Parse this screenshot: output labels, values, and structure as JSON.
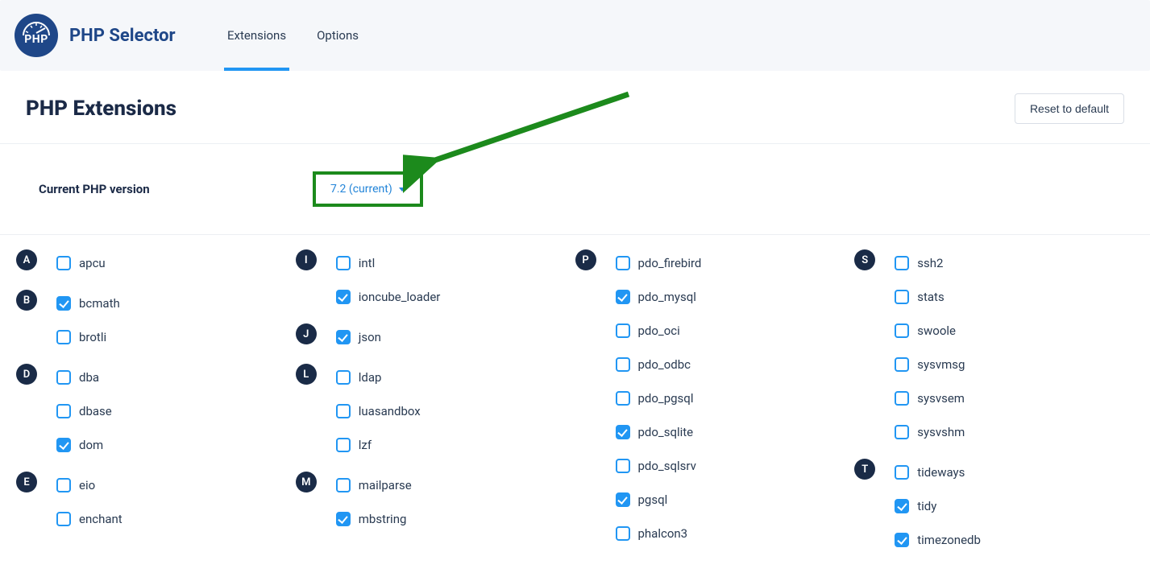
{
  "brand": "PHP Selector",
  "logo_label": "PHP",
  "tabs": {
    "extensions": "Extensions",
    "options": "Options"
  },
  "page_title": "PHP Extensions",
  "reset_label": "Reset to default",
  "version_label": "Current PHP version",
  "version_value": "7.2 (current)",
  "columns": [
    {
      "groups": [
        {
          "letter": "A",
          "items": [
            {
              "name": "apcu",
              "checked": false
            }
          ]
        },
        {
          "letter": "B",
          "items": [
            {
              "name": "bcmath",
              "checked": true
            },
            {
              "name": "brotli",
              "checked": false
            }
          ]
        },
        {
          "letter": "D",
          "items": [
            {
              "name": "dba",
              "checked": false
            },
            {
              "name": "dbase",
              "checked": false
            },
            {
              "name": "dom",
              "checked": true
            }
          ]
        },
        {
          "letter": "E",
          "items": [
            {
              "name": "eio",
              "checked": false
            },
            {
              "name": "enchant",
              "checked": false
            }
          ]
        }
      ]
    },
    {
      "groups": [
        {
          "letter": "I",
          "items": [
            {
              "name": "intl",
              "checked": false
            },
            {
              "name": "ioncube_loader",
              "checked": true
            }
          ]
        },
        {
          "letter": "J",
          "items": [
            {
              "name": "json",
              "checked": true
            }
          ]
        },
        {
          "letter": "L",
          "items": [
            {
              "name": "ldap",
              "checked": false
            },
            {
              "name": "luasandbox",
              "checked": false
            },
            {
              "name": "lzf",
              "checked": false
            }
          ]
        },
        {
          "letter": "M",
          "items": [
            {
              "name": "mailparse",
              "checked": false
            },
            {
              "name": "mbstring",
              "checked": true
            }
          ]
        }
      ]
    },
    {
      "groups": [
        {
          "letter": "P",
          "items": [
            {
              "name": "pdo_firebird",
              "checked": false
            },
            {
              "name": "pdo_mysql",
              "checked": true
            },
            {
              "name": "pdo_oci",
              "checked": false
            },
            {
              "name": "pdo_odbc",
              "checked": false
            },
            {
              "name": "pdo_pgsql",
              "checked": false
            },
            {
              "name": "pdo_sqlite",
              "checked": true
            },
            {
              "name": "pdo_sqlsrv",
              "checked": false
            },
            {
              "name": "pgsql",
              "checked": true
            },
            {
              "name": "phalcon3",
              "checked": false
            }
          ]
        }
      ]
    },
    {
      "groups": [
        {
          "letter": "S",
          "items": [
            {
              "name": "ssh2",
              "checked": false
            },
            {
              "name": "stats",
              "checked": false
            },
            {
              "name": "swoole",
              "checked": false
            },
            {
              "name": "sysvmsg",
              "checked": false
            },
            {
              "name": "sysvsem",
              "checked": false
            },
            {
              "name": "sysvshm",
              "checked": false
            }
          ]
        },
        {
          "letter": "T",
          "items": [
            {
              "name": "tideways",
              "checked": false
            },
            {
              "name": "tidy",
              "checked": true
            },
            {
              "name": "timezonedb",
              "checked": true
            }
          ]
        }
      ]
    }
  ]
}
